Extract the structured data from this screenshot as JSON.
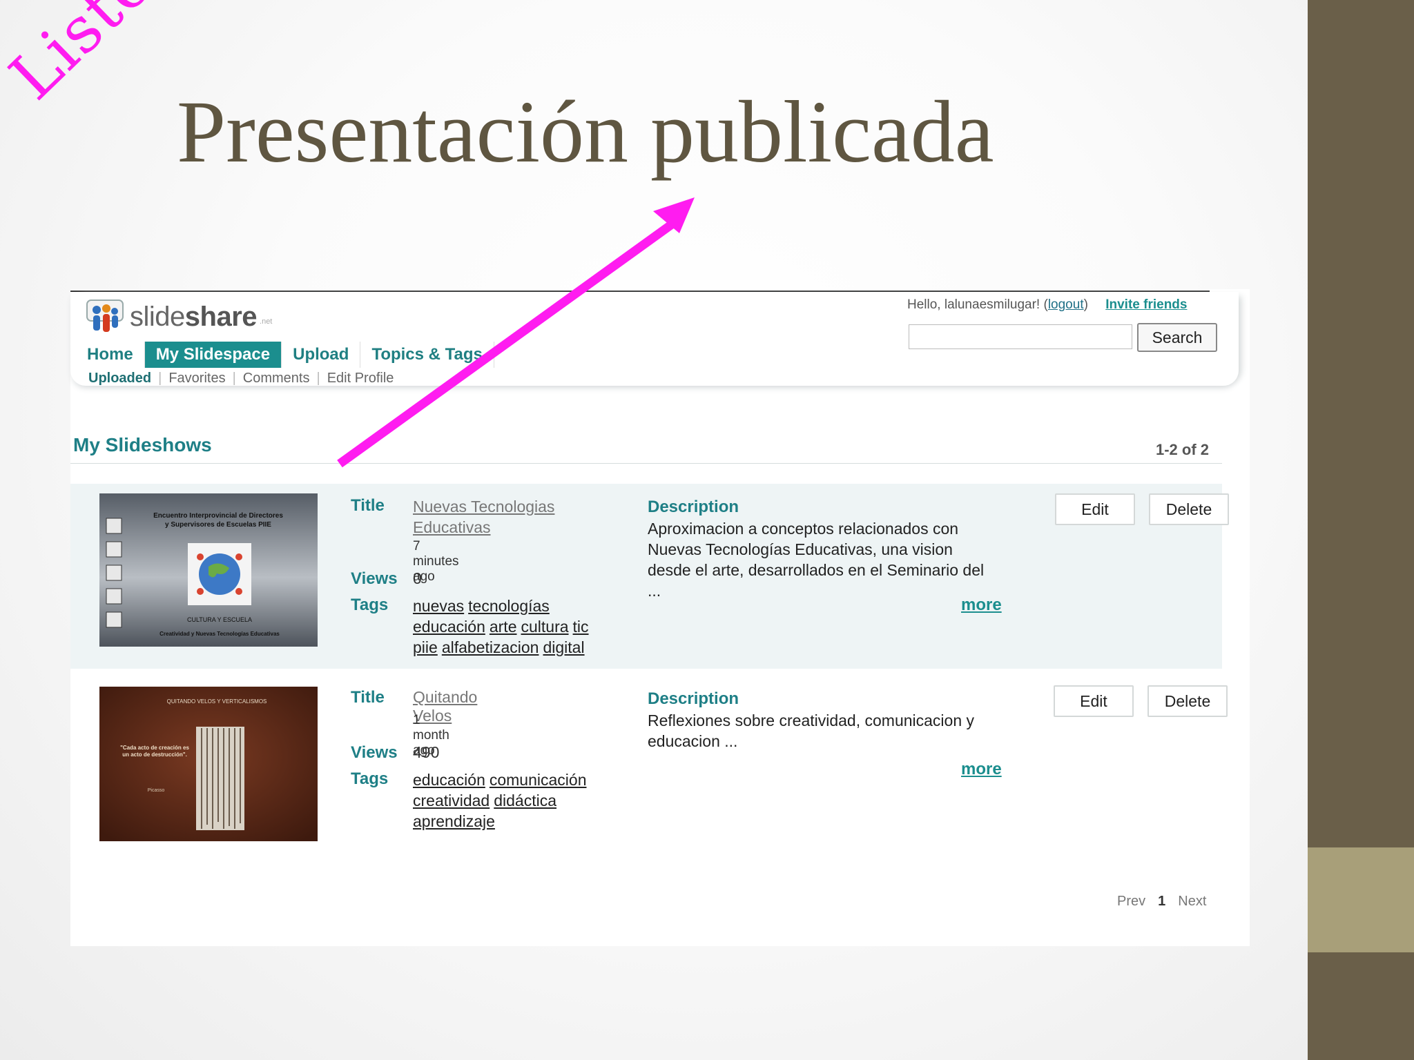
{
  "slide": {
    "stamp": "Listo",
    "title": "Presentación publicada"
  },
  "site": {
    "logo": {
      "prefix": "slide",
      "bold": "share",
      "suffix": ".net"
    },
    "nav": [
      "Home",
      "My Slidespace",
      "Upload",
      "Topics & Tags"
    ],
    "nav_active": "My Slidespace",
    "subnav": [
      "Uploaded",
      "Favorites",
      "Comments",
      "Edit Profile"
    ],
    "user": {
      "greeting": "Hello, lalunaesmilugar! (",
      "logout": "logout",
      "close": ")",
      "invite": "Invite friends"
    },
    "search": {
      "value": "",
      "button": "Search"
    }
  },
  "slideshows": {
    "heading": "My Slideshows",
    "count": "1-2 of 2",
    "labels": {
      "title": "Title",
      "views": "Views",
      "tags": "Tags",
      "description": "Description",
      "more": "more",
      "edit": "Edit",
      "delete": "Delete"
    },
    "items": [
      {
        "title": "Nuevas Tecnologias Educativas",
        "time": "7 minutes ago",
        "views": "0",
        "tags": [
          "nuevas",
          "tecnologías",
          "educación",
          "arte",
          "cultura",
          "tic",
          "piie",
          "alfabetizacion",
          "digital"
        ],
        "description": "Aproximacion a conceptos relacionados con Nuevas Tecnologías Educativas, una vision desde el arte, desarrollados en el Seminario del ...",
        "thumb": {
          "line1": "Encuentro Interprovincial de Directores",
          "line2": "y Supervisores de Escuelas PIIE",
          "line3": "CULTURA Y ESCUELA",
          "line4": "Creatividad y Nuevas Tecnologías Educativas"
        }
      },
      {
        "title": "Quitando Velos",
        "time": "1 month ago",
        "views": "490",
        "tags": [
          "educación",
          "comunicación",
          "creatividad",
          "didáctica",
          "aprendizaje"
        ],
        "description": "Reflexiones sobre creatividad, comunicacion y educacion ...",
        "thumb": {
          "line1": "QUITANDO VELOS Y VERTICALISMOS",
          "line2": "\"Cada acto de creación es un acto de destrucción\".",
          "line3": "Picasso"
        }
      }
    ]
  },
  "pager": {
    "prev": "Prev",
    "current": "1",
    "next": "Next"
  },
  "colors": {
    "accent": "#1b8e8e",
    "stamp": "#ff1cf0",
    "title": "#5f5641",
    "side_bar": "#6a5f49"
  },
  "icons": [
    "slideshare-logo-icon",
    "arrow-annotation-icon"
  ]
}
